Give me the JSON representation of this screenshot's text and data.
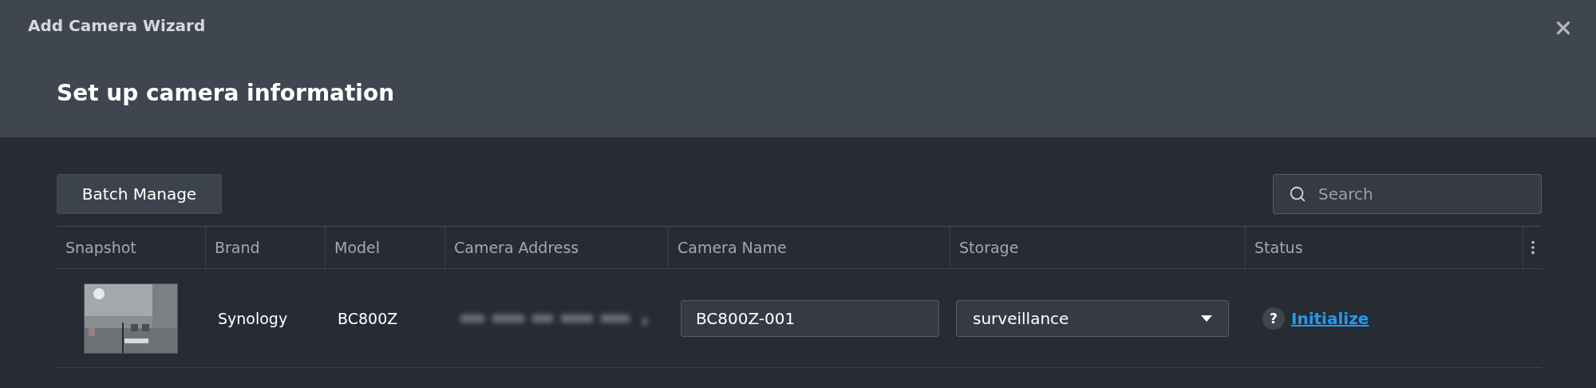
{
  "window": {
    "title": "Add Camera Wizard"
  },
  "step_title": "Set up camera information",
  "toolbar": {
    "button": "Batch Manage",
    "search": {
      "placeholder": "Search"
    }
  },
  "table": {
    "columns": [
      "Snapshot",
      "Brand",
      "Model",
      "Camera Address",
      "Camera Name",
      "Storage",
      "Status"
    ],
    "rows": [
      {
        "brand": "Synology",
        "model": "BC800Z",
        "camera_name": "BC800Z-001",
        "storage": "surveillance",
        "status": {
          "help": "?",
          "link": "Initialize"
        }
      }
    ]
  }
}
